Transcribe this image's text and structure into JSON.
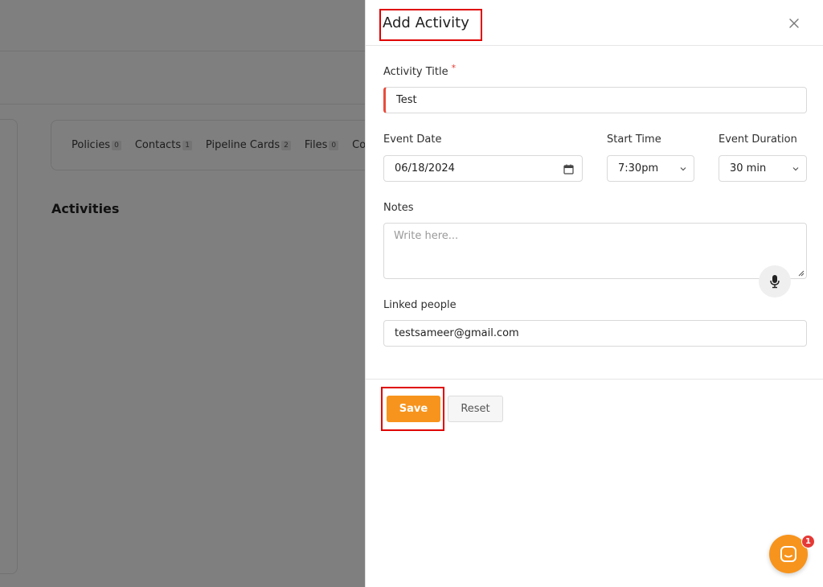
{
  "background": {
    "tabs": [
      {
        "label": "Policies",
        "count": "0"
      },
      {
        "label": "Contacts",
        "count": "1"
      },
      {
        "label": "Pipeline Cards",
        "count": "2"
      },
      {
        "label": "Files",
        "count": "0"
      },
      {
        "label": "Co",
        "count": ""
      }
    ],
    "heading": "Activities"
  },
  "drawer": {
    "title": "Add Activity",
    "close_icon": "close-icon",
    "activity_title": {
      "label": "Activity Title",
      "required_mark": "*",
      "value": "Test"
    },
    "event_date": {
      "label": "Event Date",
      "value": "06/18/2024",
      "icon": "calendar-icon"
    },
    "start_time": {
      "label": "Start Time",
      "value": "7:30pm"
    },
    "event_duration": {
      "label": "Event Duration",
      "value": "30 min"
    },
    "notes": {
      "label": "Notes",
      "placeholder": "Write here...",
      "icon": "microphone-icon"
    },
    "linked_people": {
      "label": "Linked people",
      "value": "testsameer@gmail.com"
    },
    "save_label": "Save",
    "reset_label": "Reset"
  },
  "chat": {
    "icon": "chat-icon",
    "badge": "1"
  },
  "colors": {
    "accent": "#f7941d",
    "highlight": "#e00000",
    "required": "#e53935"
  }
}
